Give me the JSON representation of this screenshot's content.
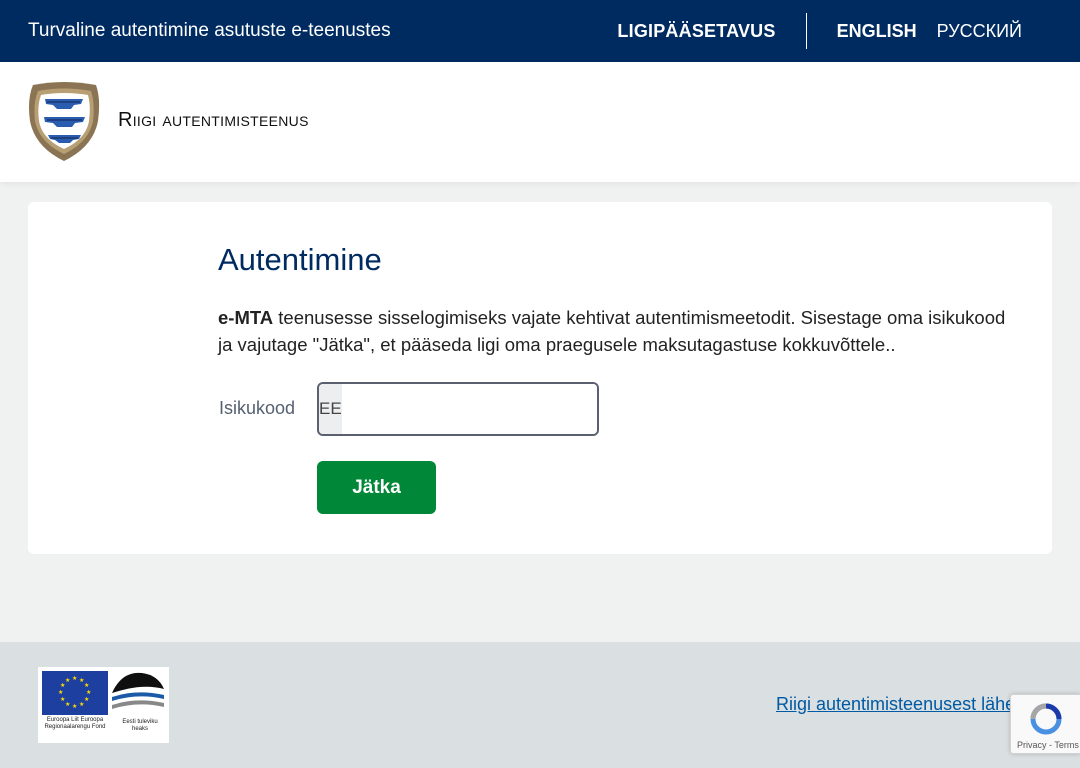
{
  "topbar": {
    "tagline": "Turvaline autentimine asutuste e-teenustes",
    "accessibility_label": "LIGIPÄÄSETAVUS",
    "languages": [
      {
        "label": "ENGLISH"
      },
      {
        "label": "РУССКИЙ"
      }
    ]
  },
  "header": {
    "brand": "Riigi autentimisteenus",
    "emblem_icon": "estonian-coat-of-arms-icon"
  },
  "auth": {
    "title": "Autentimine",
    "service_name": "e-MTA",
    "intro_text": " teenusesse sisselogimiseks vajate kehtivat autentimismeetodit. Sisestage oma isikukood ja vajutage \"Jätka\", et pääseda ligi oma praegusele maksutagastuse kokkuvõttele..",
    "field_label": "Isikukood",
    "country_prefix": "EE",
    "input_value": "",
    "continue_label": "Jätka"
  },
  "footer": {
    "eu_logo_text": "Euroopa Liit Euroopa Regionaalarengu Fond",
    "ee_logo_text": "Eesti tuleviku heaks",
    "about_link": "Riigi autentimisteenusest lähemalt"
  },
  "recaptcha": {
    "terms": "Privacy - Terms"
  },
  "colors": {
    "topbar_bg": "#002b60",
    "primary_button": "#008737",
    "link": "#005aa3"
  }
}
